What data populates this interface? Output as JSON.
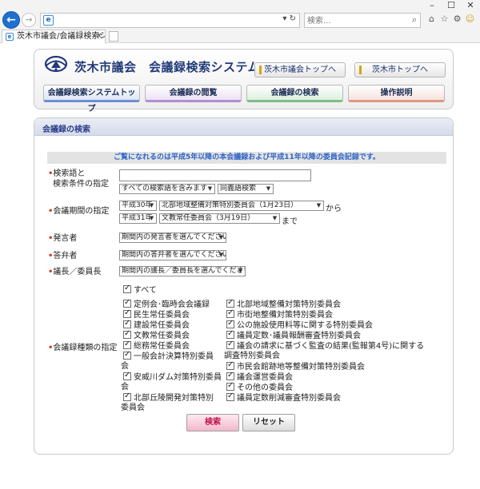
{
  "browser": {
    "window_controls": [
      "–",
      "☐",
      "✕"
    ],
    "tab_title": "茨木市議会/会議録検索シス...",
    "search_placeholder": "検索..."
  },
  "header": {
    "title": "茨木市議会　会議録検索システム",
    "links": [
      "茨木市議会トップへ",
      "茨木市トップへ"
    ],
    "nav": [
      "会議録検索システムトップ",
      "会議録の閲覧",
      "会議録の検索",
      "操作説明"
    ]
  },
  "panel": {
    "title": "会議録の検索",
    "notice": "ご覧になれるのは平成5年以降の本会議録および平成11年以降の委員会記録です。"
  },
  "form": {
    "keyword": {
      "label_line1": "検索語と",
      "label_line2": "検索条件の指定",
      "value": "",
      "condition": "すべての検索語を含みます",
      "match": "同義語検索"
    },
    "period": {
      "label": "会議期間の指定",
      "from_year": "平成30年",
      "from_meeting": "北部地域整備対策特別委員会（1月23日）",
      "from_suffix": "から",
      "to_year": "平成31年",
      "to_meeting": "文教常任委員会（3月19日）",
      "to_suffix": "まで"
    },
    "speaker": {
      "label": "発言者",
      "value": "期間内の発言者を選んでください"
    },
    "respondent": {
      "label": "答弁者",
      "value": "期間内の答弁者を選んでください"
    },
    "chair": {
      "label": "議長／委員長",
      "value": "期間内の議長／委員長を選んでください"
    },
    "types": {
      "label": "会議録種類の指定",
      "all": "すべて",
      "left_col": [
        "定例会･臨時会会議録",
        "民生常任委員会",
        "建設常任委員会",
        "文教常任委員会",
        "総務常任委員会",
        "一般会計決算特別委員",
        "会",
        "安威川ダム対策特別委員",
        "会",
        "北部丘陵開発対策特別",
        "委員会"
      ],
      "right_col": [
        "北部地域整備対策特別委員会",
        "市街地整備対策特別委員会",
        "公の施設使用料等に関する特別委員会",
        "議員定数･議員報酬審査特別委員会",
        "議会の請求に基づく監査の結果(監報第4号)に関する",
        "調査特別委員会",
        "市民会館跡地等整備対策特別委員会",
        "議会運営委員会",
        "その他の委員会",
        "議員定数削減審査特別委員会"
      ]
    },
    "buttons": {
      "search": "検索",
      "reset": "リセット"
    }
  },
  "colors": {
    "title": "#233b7a",
    "notice_text": "#2b63c6",
    "label_marker": "#c8461a",
    "search_button_text": "#c0144d"
  }
}
